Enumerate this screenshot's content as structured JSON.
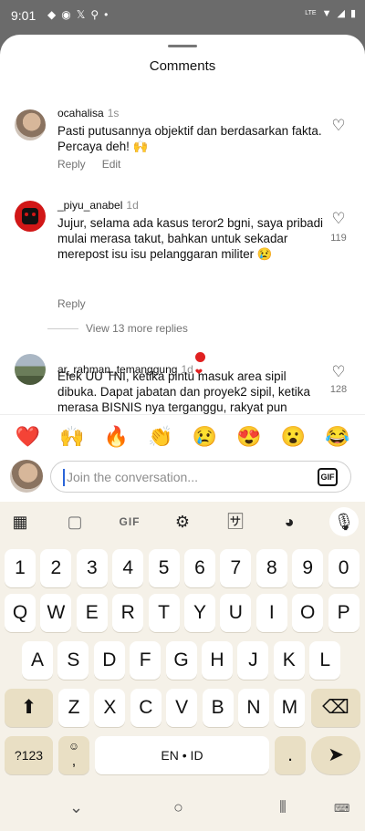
{
  "status": {
    "time": "9:01",
    "network": "LTE"
  },
  "sheet": {
    "title": "Comments"
  },
  "comments": [
    {
      "user": "ocahalisa",
      "time": "1s",
      "text": "Pasti putusannya objektif dan berdasarkan fakta. Percaya deh! 🙌",
      "actions": [
        "Reply",
        "Edit"
      ],
      "likes": ""
    },
    {
      "user": "_piyu_anabel",
      "time": "1d",
      "text": "Jujur, selama ada kasus teror2 bgni, saya pribadi mulai merasa takut, bahkan untuk sekadar merepost isu isu pelanggaran militer 😢",
      "actions": [
        "Reply"
      ],
      "likes": "119",
      "more_replies": "View 13 more replies"
    },
    {
      "user": "ar_rahman_temanggung",
      "time": "1d",
      "text": "Efek UU TNI, ketika pintu masuk area sipil dibuka. Dapat jabatan dan proyek2 sipil, ketika merasa BISNIS nya terganggu, rakyat pun dianggap MUSUH. Polisi, Jaksa, dan KPK pun tdk berani mendekat. Salut utk Andrie Yunus yg berani bersuara. Jadi ini",
      "actions": [],
      "likes": "128"
    }
  ],
  "emojis": [
    "❤️",
    "🙌",
    "🔥",
    "👏",
    "😢",
    "😍",
    "😮",
    "😂"
  ],
  "input": {
    "placeholder": "Join the conversation...",
    "gif": "GIF"
  },
  "keyboard": {
    "toolbar_gif": "GIF",
    "row_numbers": [
      "1",
      "2",
      "3",
      "4",
      "5",
      "6",
      "7",
      "8",
      "9",
      "0"
    ],
    "row1": [
      "Q",
      "W",
      "E",
      "R",
      "T",
      "Y",
      "U",
      "I",
      "O",
      "P"
    ],
    "row2": [
      "A",
      "S",
      "D",
      "F",
      "G",
      "H",
      "J",
      "K",
      "L"
    ],
    "row3": [
      "Z",
      "X",
      "C",
      "V",
      "B",
      "N",
      "M"
    ],
    "symbols": "?123",
    "comma": ",",
    "space": "EN • ID",
    "period": "."
  }
}
